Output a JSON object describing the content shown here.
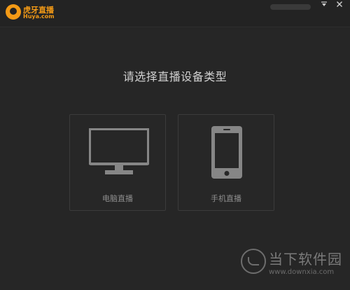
{
  "app": {
    "logo_cn": "虎牙直播",
    "logo_en": "Huya.com",
    "brand_color": "#f39a16",
    "account_name": "blurred"
  },
  "window_controls": {
    "menu_icon": "dropdown-arrow-icon",
    "close_icon": "close-icon"
  },
  "main": {
    "heading": "请选择直播设备类型",
    "options": [
      {
        "label": "电脑直播",
        "icon": "monitor-icon"
      },
      {
        "label": "手机直播",
        "icon": "smartphone-icon"
      }
    ]
  },
  "watermark": {
    "cn": "当下软件园",
    "en": "www.downxia.com"
  }
}
